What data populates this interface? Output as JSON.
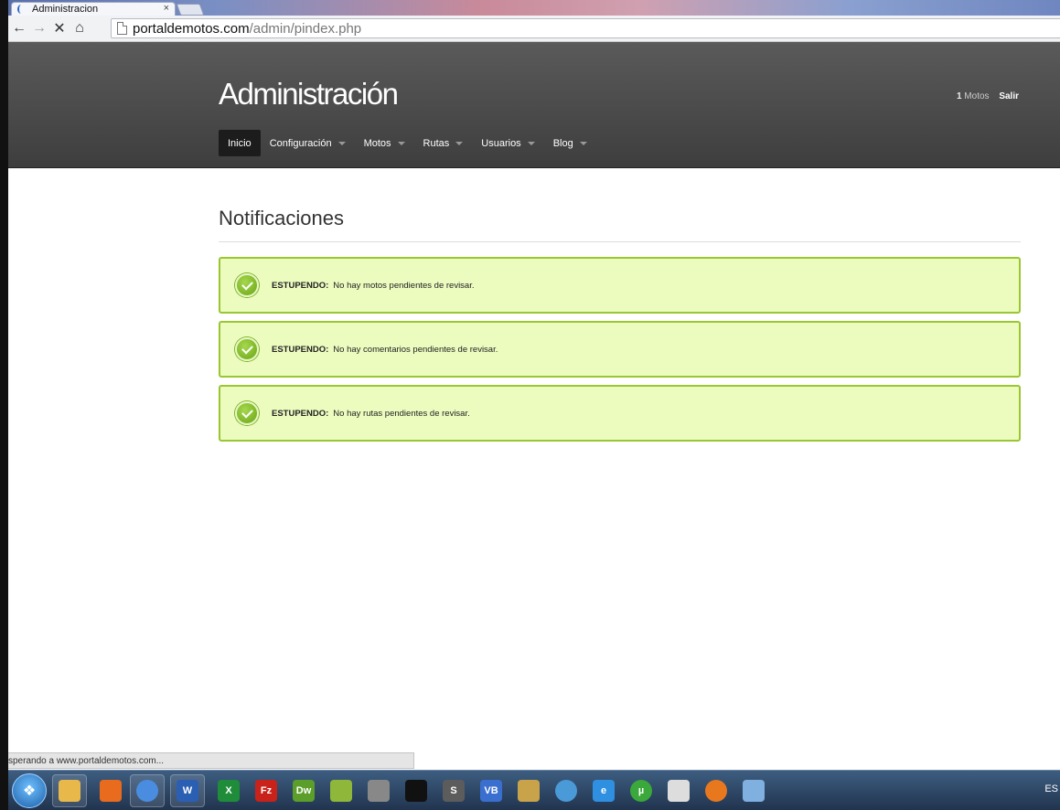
{
  "browser": {
    "tab_title": "Administracion",
    "tab_close": "×",
    "url_host": "portaldemotos.com",
    "url_path": "/admin/pindex.php",
    "status_text": "sperando a www.portaldemotos.com..."
  },
  "header": {
    "title": "Administración",
    "count_num": "1",
    "count_label": "Motos",
    "logout": "Salir"
  },
  "nav": {
    "items": [
      {
        "label": "Inicio"
      },
      {
        "label": "Configuración"
      },
      {
        "label": "Motos"
      },
      {
        "label": "Rutas"
      },
      {
        "label": "Usuarios"
      },
      {
        "label": "Blog"
      }
    ]
  },
  "main": {
    "heading": "Notificaciones",
    "alerts": [
      {
        "strong": "ESTUPENDO:",
        "text": "No hay motos pendientes de revisar."
      },
      {
        "strong": "ESTUPENDO:",
        "text": "No hay comentarios pendientes de revisar."
      },
      {
        "strong": "ESTUPENDO:",
        "text": "No hay rutas pendientes de revisar."
      }
    ]
  },
  "taskbar": {
    "lang": "ES",
    "apps": [
      {
        "name": "explorer",
        "color": "#e8b84a"
      },
      {
        "name": "media-player",
        "color": "#e86b1e"
      },
      {
        "name": "chrome",
        "color": "#4a8de0"
      },
      {
        "name": "word",
        "label": "W",
        "color": "#2b5fb3"
      },
      {
        "name": "excel",
        "label": "X",
        "color": "#1f8c3a"
      },
      {
        "name": "filezilla",
        "label": "Fz",
        "color": "#c8221a"
      },
      {
        "name": "dreamweaver",
        "label": "Dw",
        "color": "#5b9e2a"
      },
      {
        "name": "audio-editor",
        "color": "#8fb83a"
      },
      {
        "name": "app-tool",
        "color": "#888888"
      },
      {
        "name": "terminal",
        "color": "#111111"
      },
      {
        "name": "sublime",
        "label": "S",
        "color": "#5c5c5c"
      },
      {
        "name": "vb",
        "label": "VB",
        "color": "#3a6fcf"
      },
      {
        "name": "paint-brush",
        "color": "#c9a34a"
      },
      {
        "name": "disc-burner",
        "color": "#4a9ad8"
      },
      {
        "name": "internet-explorer",
        "label": "e",
        "color": "#2f8fe0"
      },
      {
        "name": "utorrent",
        "label": "µ",
        "color": "#3aa83a"
      },
      {
        "name": "window-tool",
        "color": "#dddddd"
      },
      {
        "name": "firefox",
        "color": "#e8781e"
      },
      {
        "name": "paint",
        "color": "#7fb0e0"
      }
    ]
  }
}
